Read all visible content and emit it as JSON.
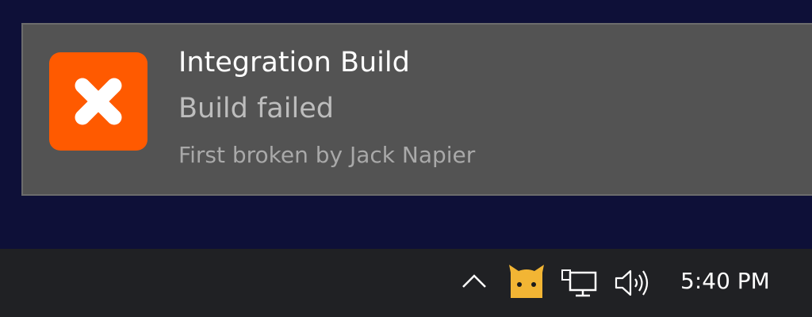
{
  "notification": {
    "title": "Integration Build",
    "message": "Build failed",
    "attribution": "First broken by Jack Napier",
    "icon": "error-x-icon",
    "accent_color": "#ff5a00"
  },
  "taskbar": {
    "tray_icons": [
      "chevron-up-icon",
      "cat-app-icon",
      "network-icon",
      "volume-icon"
    ],
    "clock": "5:40 PM"
  }
}
